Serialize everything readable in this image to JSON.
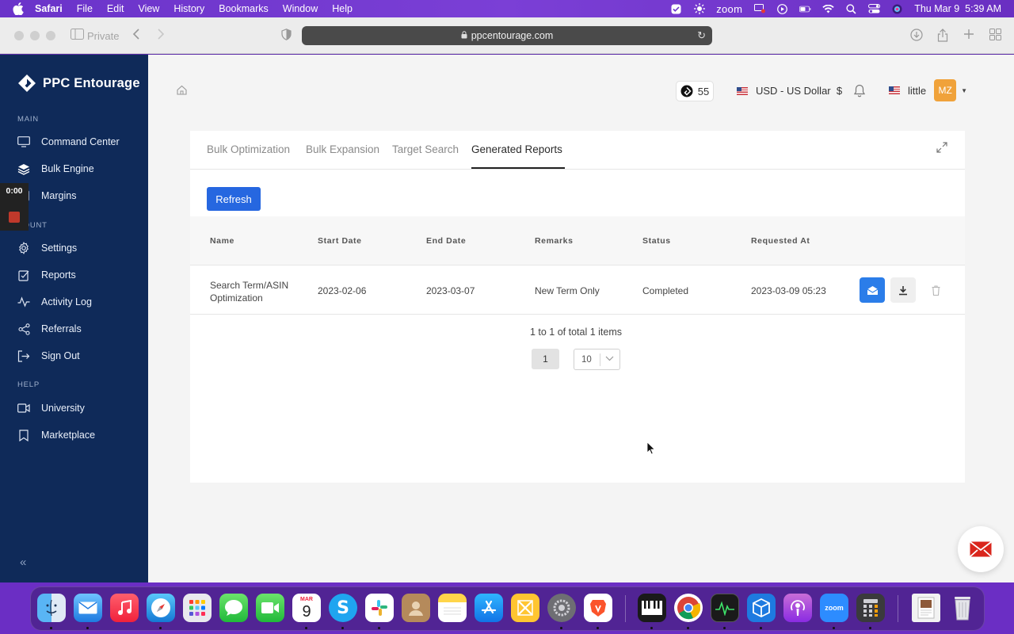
{
  "menubar": {
    "app": "Safari",
    "items": [
      "File",
      "Edit",
      "View",
      "History",
      "Bookmarks",
      "Window",
      "Help"
    ],
    "zoom_label": "zoom",
    "clock": "Thu Mar 9  5:39 AM"
  },
  "browser": {
    "private_label": "Private",
    "url": "ppcentourage.com"
  },
  "sidebar": {
    "brand": "PPC Entourage",
    "sections": {
      "main": "MAIN",
      "account": "COUNT",
      "help": "HELP"
    },
    "main_items": [
      {
        "label": "Command Center",
        "icon": "monitor-icon"
      },
      {
        "label": "Bulk Engine",
        "icon": "layers-icon"
      },
      {
        "label": "Margins",
        "icon": "margins-icon"
      }
    ],
    "account_items": [
      {
        "label": "Settings",
        "icon": "gear-icon"
      },
      {
        "label": "Reports",
        "icon": "report-icon"
      },
      {
        "label": "Activity Log",
        "icon": "activity-icon"
      },
      {
        "label": "Referrals",
        "icon": "share-icon"
      },
      {
        "label": "Sign Out",
        "icon": "sign-out-icon"
      }
    ],
    "help_items": [
      {
        "label": "University",
        "icon": "video-icon"
      },
      {
        "label": "Marketplace",
        "icon": "bookmark-icon"
      }
    ],
    "recording_time": "0:00"
  },
  "header": {
    "credits": "55",
    "currency": "USD - US Dollar  $",
    "username": "little",
    "avatar_initials": "MZ"
  },
  "tabs": [
    {
      "label": "Bulk Optimization",
      "active": false
    },
    {
      "label": "Bulk Expansion",
      "active": false
    },
    {
      "label": "Target Search",
      "active": false
    },
    {
      "label": "Generated Reports",
      "active": true
    }
  ],
  "toolbar": {
    "refresh_label": "Refresh"
  },
  "table": {
    "columns": [
      "Name",
      "Start Date",
      "End Date",
      "Remarks",
      "Status",
      "Requested At"
    ],
    "rows": [
      {
        "name_line1": "Search Term/ASIN",
        "name_line2": "Optimization",
        "start_date": "2023-02-06",
        "end_date": "2023-03-07",
        "remarks": "New Term Only",
        "status": "Completed",
        "requested_at": "2023-03-09 05:23"
      }
    ]
  },
  "pagination": {
    "summary": "1 to 1 of total 1 items",
    "current_page": "1",
    "page_size": "10"
  },
  "dock": {
    "calendar_month": "MAR",
    "calendar_day": "9",
    "zoom_label": "zoom"
  }
}
